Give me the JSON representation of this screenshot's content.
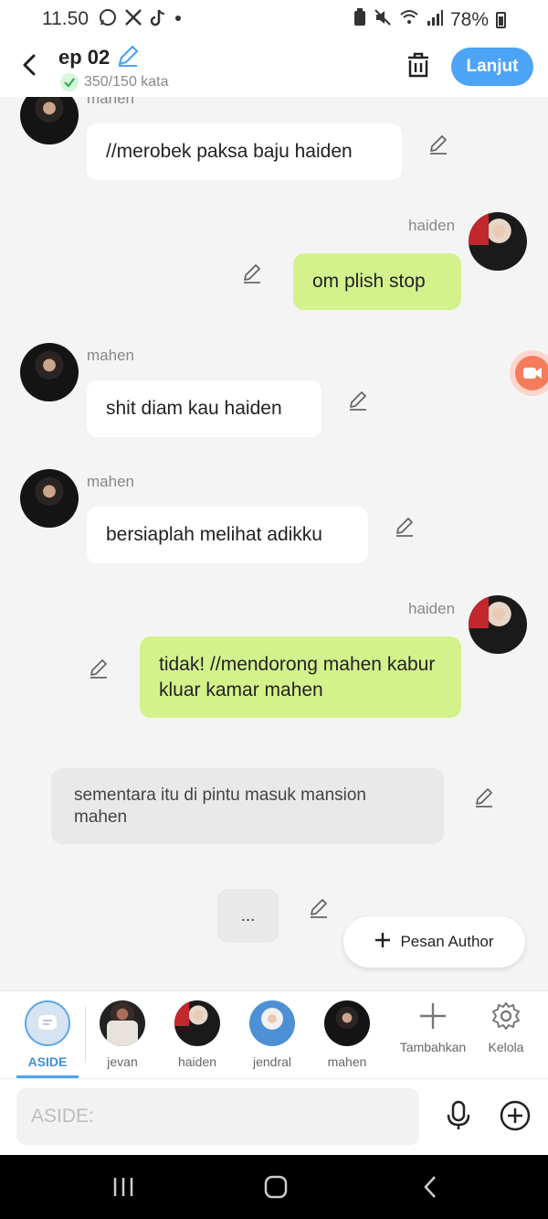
{
  "status_bar": {
    "time": "11.50",
    "battery": "78%"
  },
  "header": {
    "title": "ep 02",
    "word_count": "350/150 kata",
    "next_label": "Lanjut"
  },
  "messages": [
    {
      "sender": "mahen",
      "side": "left",
      "text": "//merobek paksa baju haiden"
    },
    {
      "sender": "haiden",
      "side": "right",
      "text": "om plish stop"
    },
    {
      "sender": "mahen",
      "side": "left",
      "text": "shit diam kau haiden"
    },
    {
      "sender": "mahen",
      "side": "left",
      "text": "bersiaplah melihat adikku"
    },
    {
      "sender": "haiden",
      "side": "right",
      "text": "tidak! //mendorong mahen kabur kluar kamar mahen"
    },
    {
      "sender": "aside",
      "side": "center",
      "text": "sementara itu di pintu masuk mansion mahen"
    },
    {
      "sender": "aside",
      "side": "center",
      "text": "..."
    }
  ],
  "author_button": {
    "label": "Pesan Author"
  },
  "characters": [
    {
      "label": "ASIDE",
      "selected": true
    },
    {
      "label": "jevan"
    },
    {
      "label": "haiden"
    },
    {
      "label": "jendral"
    },
    {
      "label": "mahen"
    }
  ],
  "tools": {
    "add_label": "Tambahkan",
    "manage_label": "Kelola"
  },
  "input": {
    "placeholder": "ASIDE:"
  },
  "colors": {
    "accent": "#4da3f5",
    "bubble_right": "#d4f28c",
    "bubble_left": "#ffffff",
    "record": "#f47b5b"
  }
}
